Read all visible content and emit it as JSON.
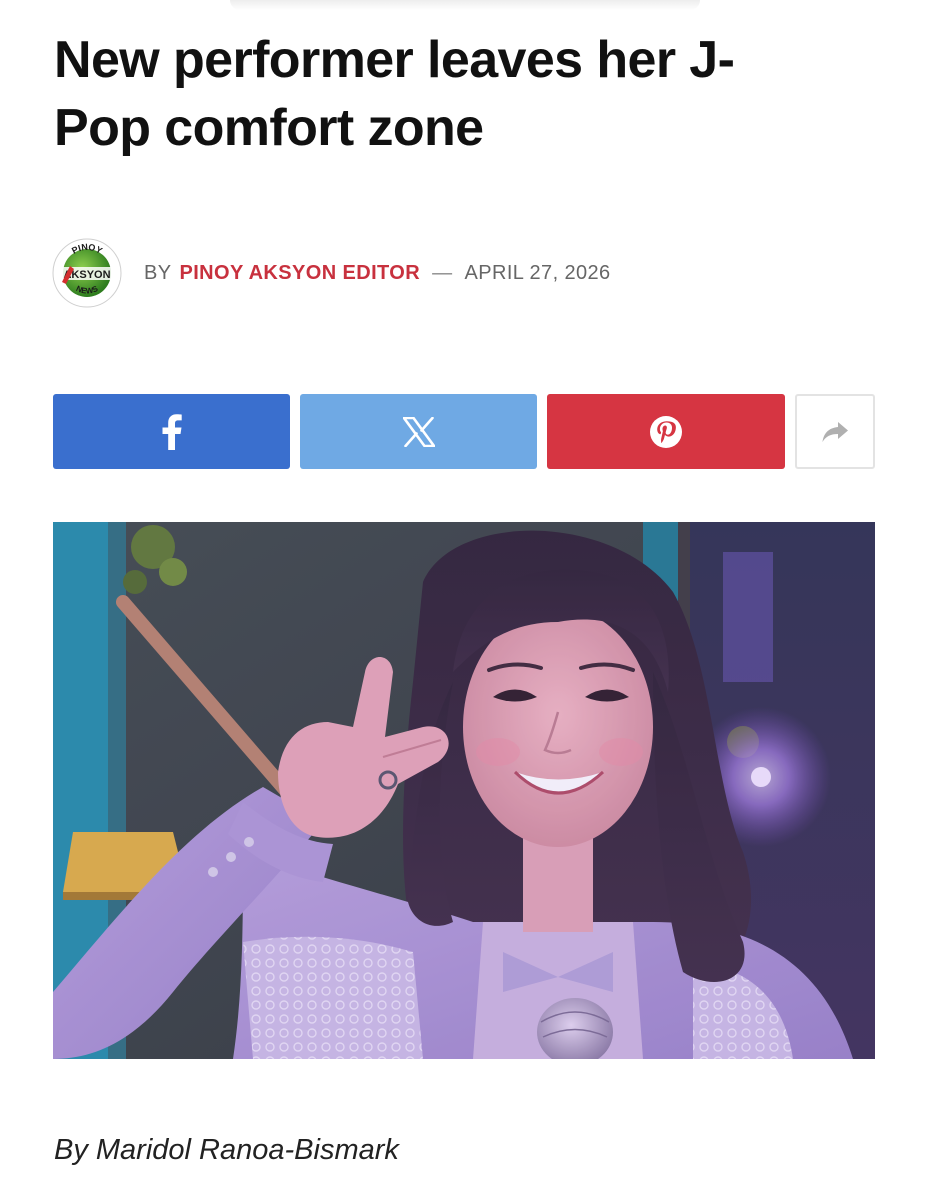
{
  "article": {
    "headline": "New performer leaves her  J-\nPop comfort zone",
    "byline": {
      "prefix": "BY",
      "author": "PINOY AKSYON EDITOR",
      "separator": "—",
      "date": "APRIL 27, 2026"
    },
    "publisher_logo": {
      "icon": "pinoy-aksyon-news-logo",
      "text_top": "PINOY",
      "text_middle": "AKSYON",
      "text_bottom": "NEWS"
    },
    "share_buttons": [
      {
        "network": "facebook",
        "icon": "facebook-icon",
        "color": "#3a6fce"
      },
      {
        "network": "x",
        "icon": "x-icon",
        "color": "#6fa9e4"
      },
      {
        "network": "pinterest",
        "icon": "pinterest-icon",
        "color": "#d63542"
      },
      {
        "network": "more",
        "icon": "share-arrow-icon",
        "color": "#ffffff"
      }
    ],
    "featured_image": {
      "subject": "young woman in lavender jacket making peace sign, holding microphone"
    },
    "credit": "By Maridol Ranoa-Bismark"
  },
  "colors": {
    "accent": "#c8313e",
    "text": "#111111",
    "muted": "#666666"
  }
}
